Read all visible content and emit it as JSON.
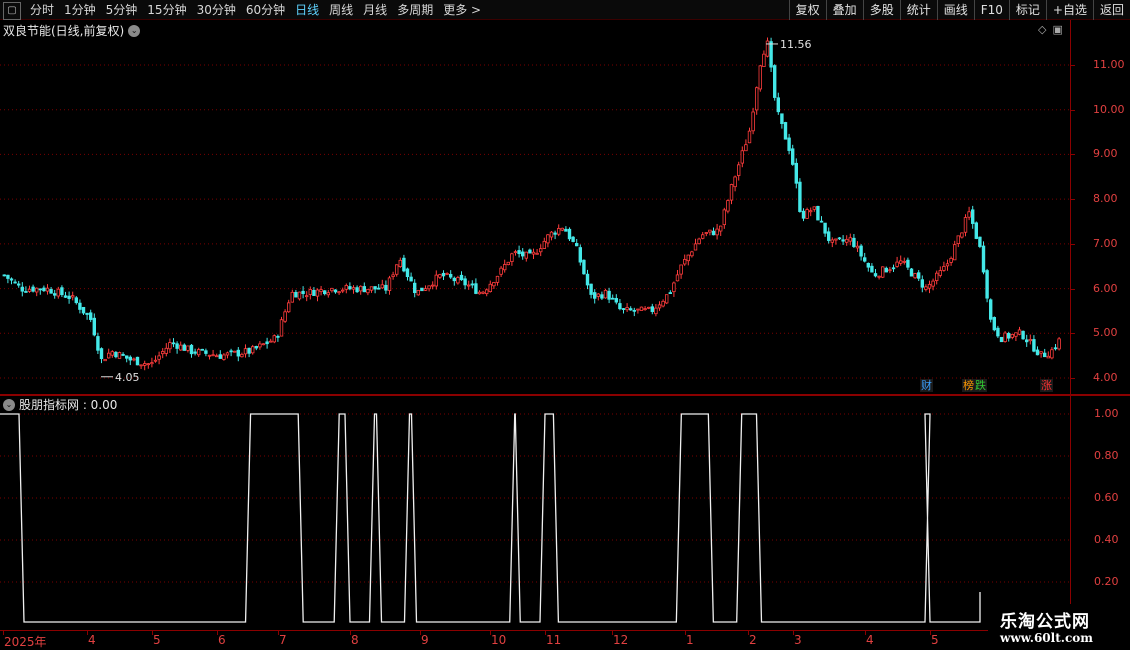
{
  "toolbar": {
    "box_icon_glyph": "▢",
    "periods": [
      {
        "label": "分时",
        "active": false
      },
      {
        "label": "1分钟",
        "active": false
      },
      {
        "label": "5分钟",
        "active": false
      },
      {
        "label": "15分钟",
        "active": false
      },
      {
        "label": "30分钟",
        "active": false
      },
      {
        "label": "60分钟",
        "active": false
      },
      {
        "label": "日线",
        "active": true
      },
      {
        "label": "周线",
        "active": false
      },
      {
        "label": "月线",
        "active": false
      },
      {
        "label": "多周期",
        "active": false
      },
      {
        "label": "更多 >",
        "active": false
      }
    ],
    "right_buttons": [
      "复权",
      "叠加",
      "多股",
      "统计",
      "画线",
      "F10",
      "标记",
      "+自选",
      "返回"
    ]
  },
  "main": {
    "title": "双良节能(日线,前复权)",
    "high_label": "11.56",
    "low_label": "4.05",
    "price_axis": [
      "11.00",
      "10.00",
      "9.00",
      "8.00",
      "7.00",
      "6.00",
      "5.00",
      "4.00"
    ],
    "markers": [
      {
        "text": "财",
        "color": "#3aa0ff"
      },
      {
        "text": "榜",
        "color": "#ff9900"
      },
      {
        "text": "跌",
        "color": "#33cc33"
      },
      {
        "text": "涨",
        "color": "#ff3333"
      }
    ]
  },
  "indicator": {
    "title": "股朋指标网 : 0.00",
    "axis": [
      "1.00",
      "0.80",
      "0.60",
      "0.40",
      "0.20"
    ]
  },
  "date_axis": [
    "2025年",
    "4",
    "5",
    "6",
    "7",
    "8",
    "9",
    "10",
    "11",
    "12",
    "1",
    "2",
    "3",
    "4",
    "5"
  ],
  "watermark": {
    "title": "乐淘公式网",
    "url": "www.60lt.com"
  },
  "chart_data": [
    {
      "type": "candlestick",
      "title": "双良节能(日线,前复权)",
      "ylim": [
        3.8,
        11.7
      ],
      "y_ticks": [
        4.0,
        5.0,
        6.0,
        7.0,
        8.0,
        9.0,
        10.0,
        11.0
      ],
      "annotations": [
        {
          "text": "11.56",
          "type": "max"
        },
        {
          "text": "4.05",
          "type": "min"
        }
      ],
      "close_trend": [
        {
          "x": "2025年",
          "y": 6.3
        },
        {
          "x": "4",
          "y": 4.5
        },
        {
          "x": "5",
          "y": 4.7
        },
        {
          "x": "6",
          "y": 4.6
        },
        {
          "x": "7",
          "y": 6.0
        },
        {
          "x": "8",
          "y": 6.1
        },
        {
          "x": "9",
          "y": 6.2
        },
        {
          "x": "10",
          "y": 6.8
        },
        {
          "x": "11",
          "y": 7.3
        },
        {
          "x": "12",
          "y": 5.6
        },
        {
          "x": "1",
          "y": 7.4
        },
        {
          "x": "2",
          "y": 11.5
        },
        {
          "x": "3",
          "y": 7.6
        },
        {
          "x": "4",
          "y": 6.5
        },
        {
          "x": "5",
          "y": 7.8
        },
        {
          "x": "5",
          "y": 4.9
        }
      ]
    },
    {
      "type": "line",
      "title": "股朋指标网",
      "ylim": [
        0,
        1.0
      ],
      "y_ticks": [
        0.2,
        0.4,
        0.6,
        0.8,
        1.0
      ],
      "high_segments_x_px": "pulse",
      "pulses_on_date_index": [
        [
          0.0,
          0.25
        ],
        [
          3.55,
          4.35
        ],
        [
          4.85,
          5.0
        ],
        [
          5.35,
          5.45
        ],
        [
          5.85,
          5.95
        ],
        [
          7.45,
          7.55
        ],
        [
          8.0,
          8.2
        ],
        [
          9.95,
          10.45
        ],
        [
          10.9,
          11.3
        ],
        [
          14.15,
          14.25
        ]
      ]
    }
  ]
}
